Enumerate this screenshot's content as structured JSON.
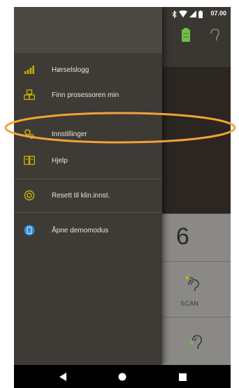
{
  "status_bar": {
    "time": "07.00",
    "icons": [
      "bluetooth-icon",
      "wifi-icon",
      "signal-icon",
      "battery-icon"
    ]
  },
  "drawer": {
    "items": [
      {
        "label": "Hørselslogg",
        "icon": "signal-bars-icon"
      },
      {
        "label": "Finn prosessoren min",
        "icon": "cubes-icon"
      },
      {
        "label": "Innstillinger",
        "icon": "settings-gears-icon"
      },
      {
        "label": "Hjelp",
        "icon": "help-book-icon"
      },
      {
        "label": "Resett til klin.innst.",
        "icon": "reset-icon"
      },
      {
        "label": "Åpne demomodus",
        "icon": "demo-icon"
      }
    ]
  },
  "background_app": {
    "program_number": "6",
    "scan_label": "SCAN"
  },
  "colors": {
    "accent": "#c9b400",
    "highlight_ring": "#f2a23a",
    "battery_green": "#6cc04a",
    "demo_blue": "#2f8fd6"
  }
}
